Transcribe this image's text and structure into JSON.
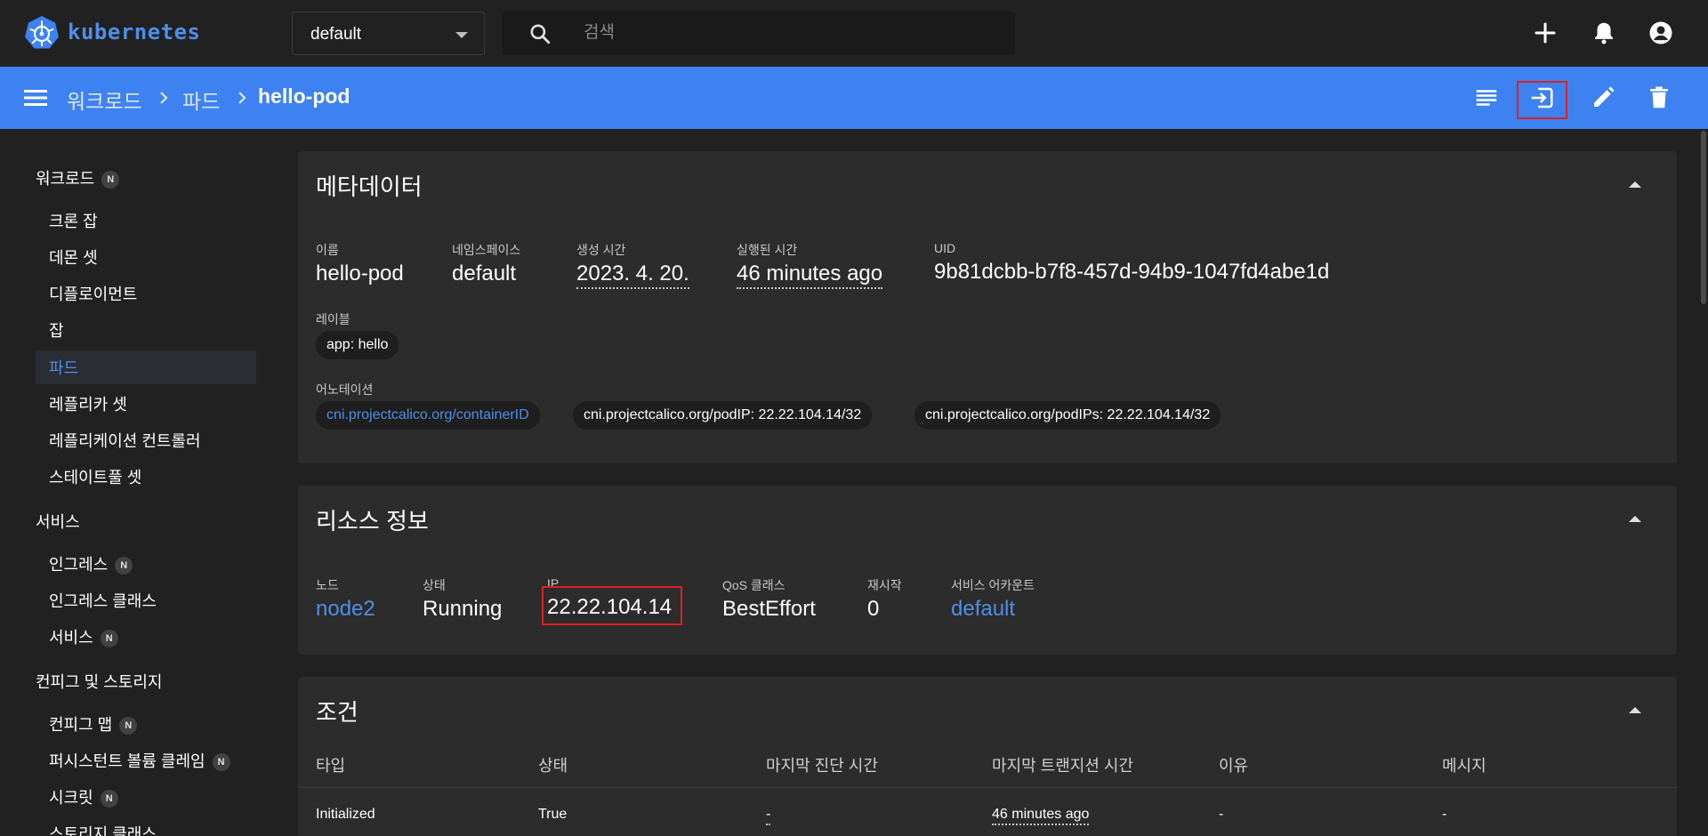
{
  "header": {
    "logo_text": "kubernetes",
    "namespace": "default",
    "search_placeholder": "검색"
  },
  "breadcrumb": {
    "items": [
      "워크로드",
      "파드"
    ],
    "current": "hello-pod"
  },
  "sidebar": {
    "groups": [
      {
        "label": "워크로드",
        "badge": "N",
        "items": [
          {
            "label": "크론 잡"
          },
          {
            "label": "데몬 셋"
          },
          {
            "label": "디플로이먼트"
          },
          {
            "label": "잡"
          },
          {
            "label": "파드",
            "active": true
          },
          {
            "label": "레플리카 셋"
          },
          {
            "label": "레플리케이션 컨트롤러"
          },
          {
            "label": "스테이트풀 셋"
          }
        ]
      },
      {
        "label": "서비스",
        "items": [
          {
            "label": "인그레스",
            "badge": "N"
          },
          {
            "label": "인그레스 클래스"
          },
          {
            "label": "서비스",
            "badge": "N"
          }
        ]
      },
      {
        "label": "컨피그 및 스토리지",
        "items": [
          {
            "label": "컨피그 맵",
            "badge": "N"
          },
          {
            "label": "퍼시스턴트 볼륨 클레임",
            "badge": "N"
          },
          {
            "label": "시크릿",
            "badge": "N"
          },
          {
            "label": "스토리지 클래스"
          }
        ]
      }
    ]
  },
  "metadata": {
    "title": "메타데이터",
    "fields": {
      "name_label": "이름",
      "name": "hello-pod",
      "namespace_label": "네임스페이스",
      "namespace": "default",
      "created_label": "생성 시간",
      "created": "2023. 4. 20.",
      "age_label": "실행된 시간",
      "age": "46 minutes ago",
      "uid_label": "UID",
      "uid": "9b81dcbb-b7f8-457d-94b9-1047fd4abe1d"
    },
    "labels_label": "레이블",
    "labels": [
      "app: hello"
    ],
    "annotations_label": "어노테이션",
    "annotations": [
      "cni.projectcalico.org/containerID",
      "cni.projectcalico.org/podIP: 22.22.104.14/32",
      "cni.projectcalico.org/podIPs: 22.22.104.14/32"
    ]
  },
  "resource": {
    "title": "리소스 정보",
    "node_label": "노드",
    "node": "node2",
    "status_label": "상태",
    "status": "Running",
    "ip_label": "IP",
    "ip": "22.22.104.14",
    "qos_label": "QoS 클래스",
    "qos": "BestEffort",
    "restarts_label": "재시작",
    "restarts": "0",
    "sa_label": "서비스 어카운트",
    "sa": "default"
  },
  "conditions": {
    "title": "조건",
    "columns": [
      "타입",
      "상태",
      "마지막 진단 시간",
      "마지막 트랜지션 시간",
      "이유",
      "메시지"
    ],
    "rows": [
      [
        "Initialized",
        "True",
        "-",
        "46 minutes ago",
        "-",
        "-"
      ]
    ]
  },
  "colors": {
    "appbar": "#3d82f0",
    "accent": "#4e8fe8",
    "highlight": "#e02020"
  }
}
